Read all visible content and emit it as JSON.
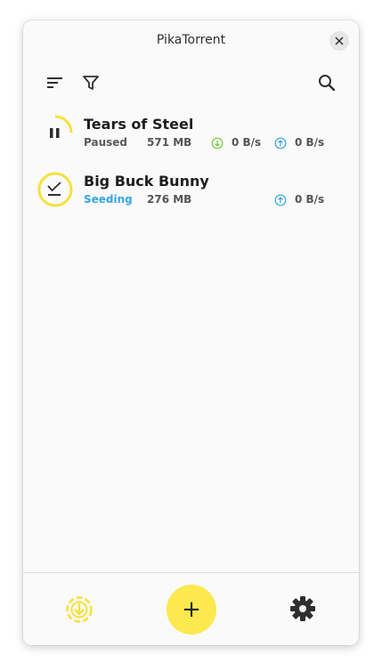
{
  "window": {
    "title": "PikaTorrent"
  },
  "toolbar": {
    "sort_icon": "sort-icon",
    "filter_icon": "filter-icon",
    "search_icon": "search-icon"
  },
  "torrents": [
    {
      "name": "Tears of Steel",
      "status": "Paused",
      "size": "571 MB",
      "download_speed": "0 B/s",
      "upload_speed": "0 B/s",
      "progress": 0.3,
      "status_color": "#5a5a5a"
    },
    {
      "name": "Big Buck Bunny",
      "status": "Seeding",
      "size": "276 MB",
      "upload_speed": "0 B/s",
      "progress": 1.0,
      "status_color": "#35a6e0"
    }
  ],
  "bottombar": {
    "add_label": "+",
    "downloads_icon": "download-progress-icon",
    "settings_icon": "gear-icon"
  },
  "colors": {
    "accent": "#fce94f",
    "ring": "#f6e13d",
    "download": "#73c93a",
    "upload": "#35a6e0"
  }
}
